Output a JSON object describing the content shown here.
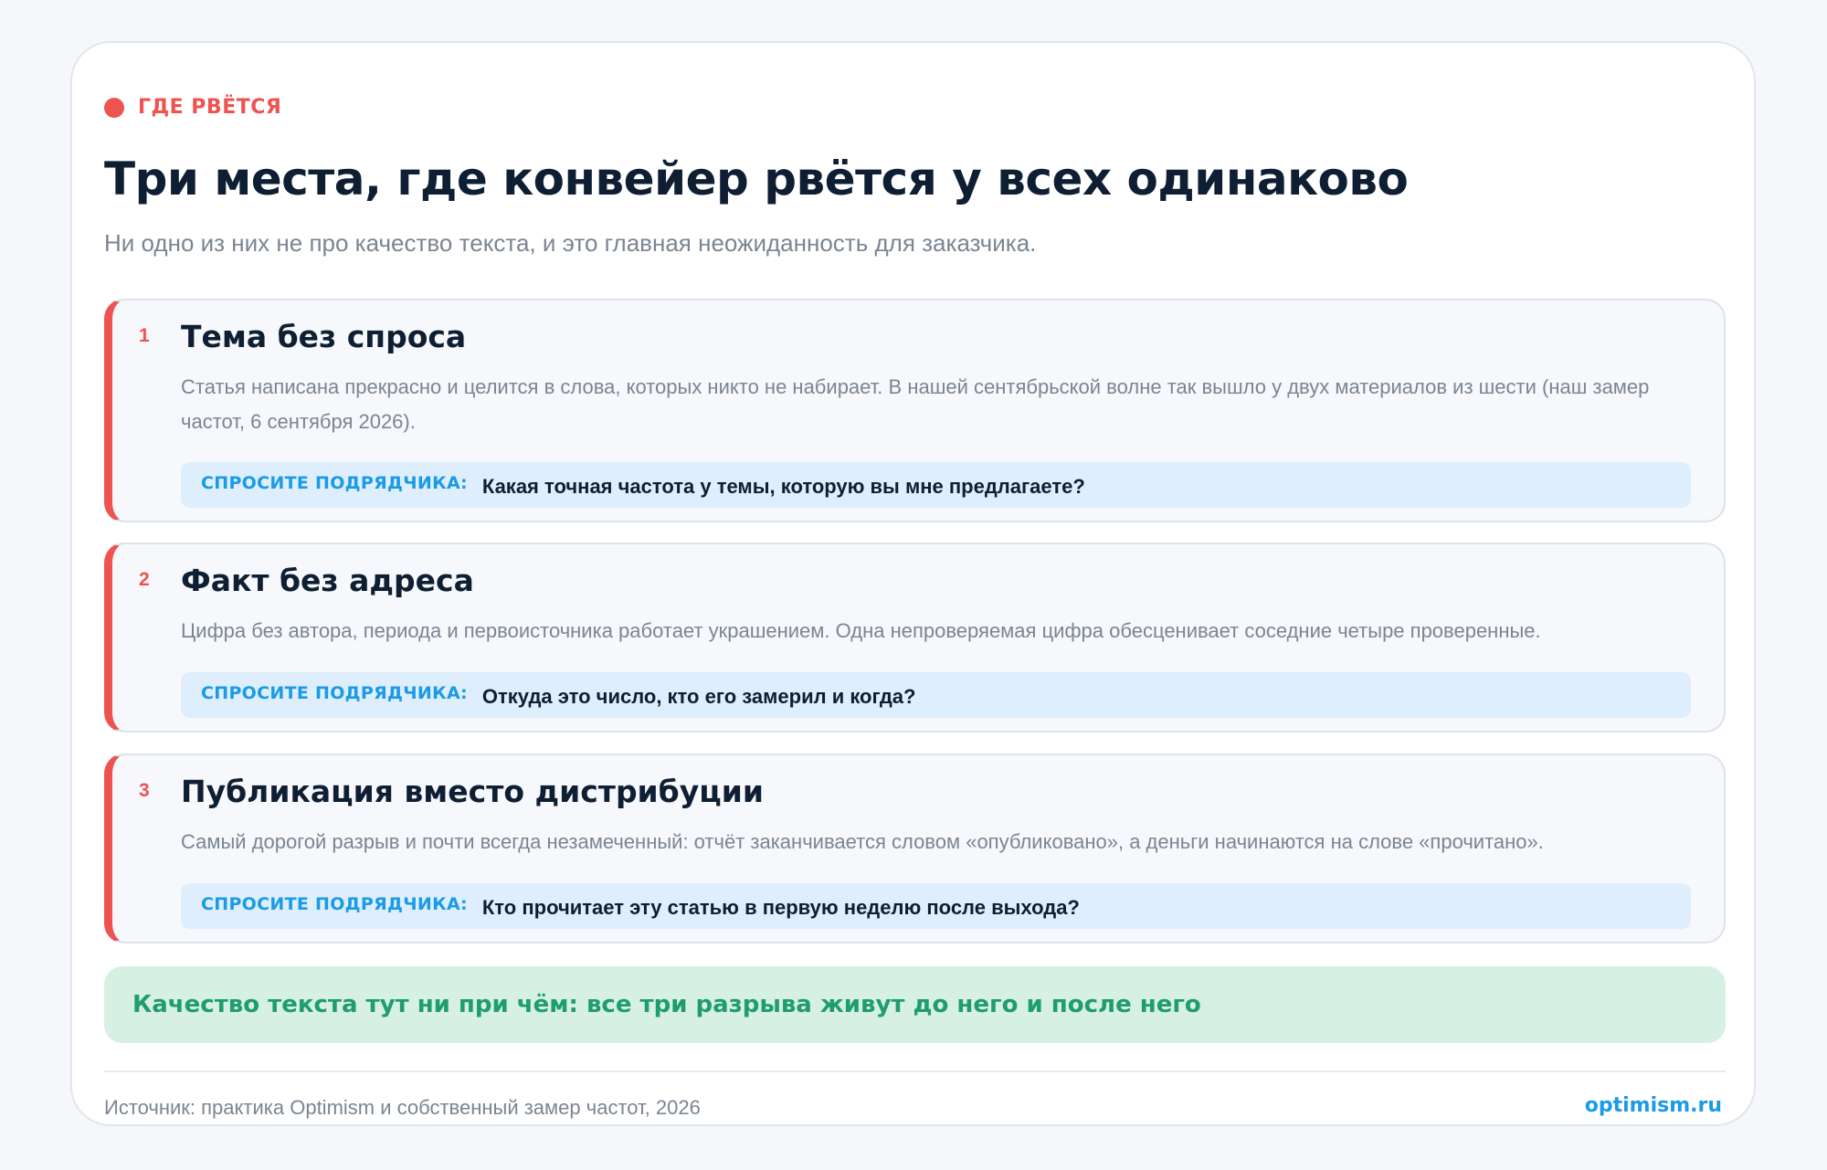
{
  "eyebrow": {
    "label": "ГДЕ РВЁТСЯ"
  },
  "header": {
    "title": "Три места, где конвейер рвётся у всех одинаково",
    "subtitle": "Ни одно из них не про качество текста, и это главная неожиданность для заказчика."
  },
  "items": [
    {
      "number": "1",
      "title": "Тема без спроса",
      "description": "Статья написана прекрасно и целится в слова, которых никто не набирает. В нашей сентябрьской волне так вышло у двух материалов из шести (наш замер частот, 6 сентября 2026).",
      "ask_label": "СПРОСИТЕ ПОДРЯДЧИКА:",
      "ask_question": "Какая точная частота у темы, которую вы мне предлагаете?"
    },
    {
      "number": "2",
      "title": "Факт без адреса",
      "description": "Цифра без автора, периода и первоисточника работает украшением. Одна непроверяемая цифра обесценивает соседние четыре проверенные.",
      "ask_label": "СПРОСИТЕ ПОДРЯДЧИКА:",
      "ask_question": "Откуда это число, кто его замерил и когда?"
    },
    {
      "number": "3",
      "title": "Публикация вместо дистрибуции",
      "description": "Самый дорогой разрыв и почти всегда незамеченный: отчёт заканчивается словом «опубликовано», а деньги начинаются на слове «прочитано».",
      "ask_label": "СПРОСИТЕ ПОДРЯДЧИКА:",
      "ask_question": "Кто прочитает эту статью в первую неделю после выхода?"
    }
  ],
  "callout": {
    "text": "Качество текста тут ни при чём: все три разрыва живут до него и после него"
  },
  "footer": {
    "source": "Источник: практика Optimism и собственный замер частот, 2026",
    "brand": "optimism.ru"
  },
  "colors": {
    "accent": "#ef5350",
    "link": "#1a9be5",
    "success": "#1f9d6b",
    "callout_bg": "#d6f0e4",
    "ask_bg": "#deeefc",
    "ink": "#0f1f33",
    "muted": "#7b8592"
  }
}
